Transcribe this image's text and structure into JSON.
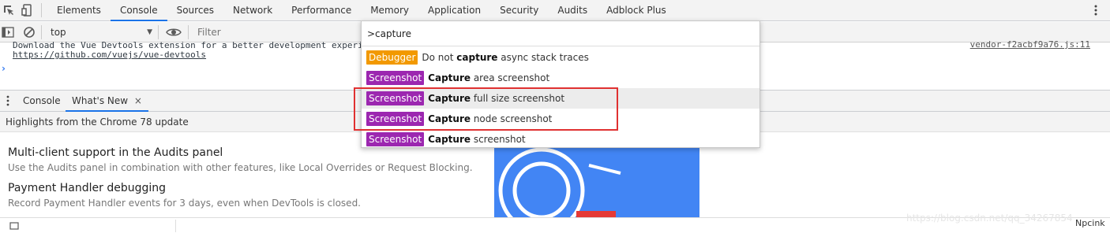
{
  "toolbar": {
    "tabs": [
      "Elements",
      "Console",
      "Sources",
      "Network",
      "Performance",
      "Memory",
      "Application",
      "Security",
      "Audits",
      "Adblock Plus"
    ],
    "active_tab": "Console"
  },
  "console_toolbar": {
    "context": "top",
    "filter_placeholder": "Filter"
  },
  "output": {
    "line1": "Download the Vue Devtools extension for a better development experi",
    "line2": "https://github.com/vuejs/vue-devtools",
    "source": "vendor-f2acbf9a76.js:11",
    "prompt": "›"
  },
  "drawer": {
    "tabs": [
      "Console",
      "What's New"
    ],
    "close": "×",
    "highlights": "Highlights from the Chrome 78 update",
    "features": [
      {
        "title": "Multi-client support in the Audits panel",
        "desc": "Use the Audits panel in combination with other features, like Local Overrides or Request Blocking."
      },
      {
        "title": "Payment Handler debugging",
        "desc": "Record Payment Handler events for 3 days, even when DevTools is closed."
      }
    ],
    "partial_label": "Npcink"
  },
  "command_menu": {
    "input_value": ">capture",
    "items": [
      {
        "badge": "Debugger",
        "badge_color": "#f29900",
        "pre": "Do not ",
        "bold": "capture",
        "post": " async stack traces"
      },
      {
        "badge": "Screenshot",
        "badge_color": "#9c27b0",
        "pre": "",
        "bold": "Capture",
        "post": " area screenshot"
      },
      {
        "badge": "Screenshot",
        "badge_color": "#9c27b0",
        "pre": "",
        "bold": "Capture",
        "post": " full size screenshot"
      },
      {
        "badge": "Screenshot",
        "badge_color": "#9c27b0",
        "pre": "",
        "bold": "Capture",
        "post": " node screenshot"
      },
      {
        "badge": "Screenshot",
        "badge_color": "#9c27b0",
        "pre": "",
        "bold": "Capture",
        "post": " screenshot"
      }
    ]
  },
  "watermark": "https://blog.csdn.net/qq_34267854",
  "colors": {
    "accent": "#1a73e8",
    "highlight_box": "#e03131",
    "art_blue": "#4285f4"
  },
  "icons": [
    "inspect-icon",
    "device-icon",
    "more-vert-icon",
    "sidebar-toggle-icon",
    "clear-console-icon",
    "eye-icon",
    "drawer-menu-icon"
  ]
}
